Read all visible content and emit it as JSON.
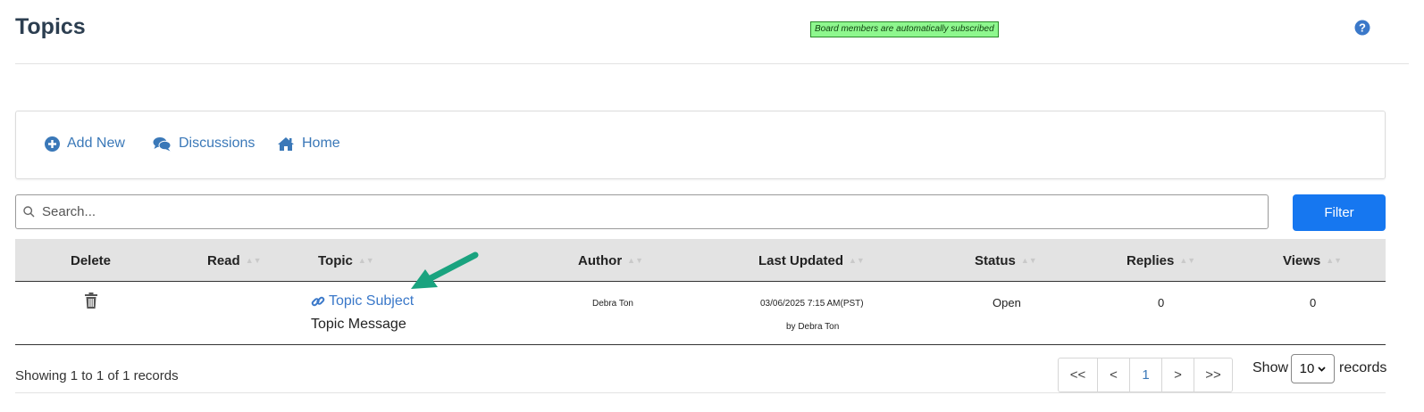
{
  "header": {
    "title": "Topics",
    "notice": "Board members are automatically subscribed"
  },
  "toolbar": {
    "add_new": "Add New",
    "discussions": "Discussions",
    "home": "Home"
  },
  "search": {
    "placeholder": "Search...",
    "value": "",
    "filter_label": "Filter"
  },
  "table": {
    "columns": [
      "Delete",
      "Read",
      "Topic",
      "Author",
      "Last Updated",
      "Status",
      "Replies",
      "Views"
    ],
    "rows": [
      {
        "topic_subject": "Topic Subject",
        "topic_message": "Topic Message",
        "author": "Debra Ton",
        "last_updated": "03/06/2025 7:15 AM(PST)",
        "updated_by": "by Debra Ton",
        "status": "Open",
        "replies": "0",
        "views": "0"
      }
    ]
  },
  "footer": {
    "showing": "Showing 1 to 1 of 1 records",
    "pager": [
      "<<",
      "<",
      "1",
      ">",
      ">>"
    ],
    "show_label": "Show",
    "page_size": "10",
    "records_label": "records"
  },
  "colors": {
    "link": "#3a78b8",
    "primary_button": "#1677f0",
    "notice_bg": "#8ef78e",
    "annotation_arrow": "#1aa37f"
  }
}
